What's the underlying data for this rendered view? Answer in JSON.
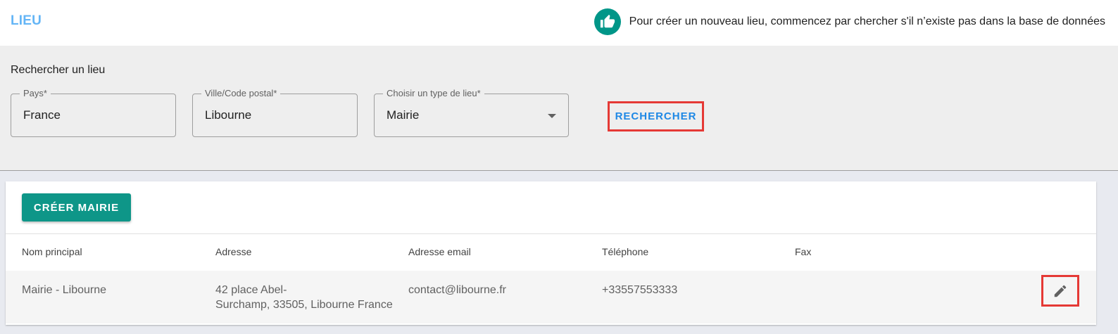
{
  "header": {
    "title": "LIEU",
    "hint": "Pour créer un nouveau lieu, commencez par chercher s'il n’existe pas dans la base de données",
    "hint_icon": "thumb-up-icon"
  },
  "search": {
    "heading": "Rechercher un lieu",
    "country": {
      "label": "Pays*",
      "value": "France"
    },
    "city": {
      "label": "Ville/Code postal*",
      "value": "Libourne"
    },
    "type": {
      "label": "Choisir un type de lieu*",
      "value": "Mairie"
    },
    "search_button": "RECHERCHER"
  },
  "results": {
    "create_button": "CRÉER MAIRIE",
    "columns": [
      "Nom principal",
      "Adresse",
      "Adresse email",
      "Téléphone",
      "Fax"
    ],
    "rows": [
      {
        "name": "Mairie - Libourne",
        "address_line1": "42 place Abel-",
        "address_line2": "Surchamp, 33505, Libourne France",
        "email": "contact@libourne.fr",
        "phone": "+33557553333",
        "fax": "",
        "edit_icon": "pencil-icon"
      }
    ]
  },
  "colors": {
    "accent": "#64b5f6",
    "primary": "#0e9688",
    "highlight": "#e53935",
    "link": "#1e88e5"
  }
}
